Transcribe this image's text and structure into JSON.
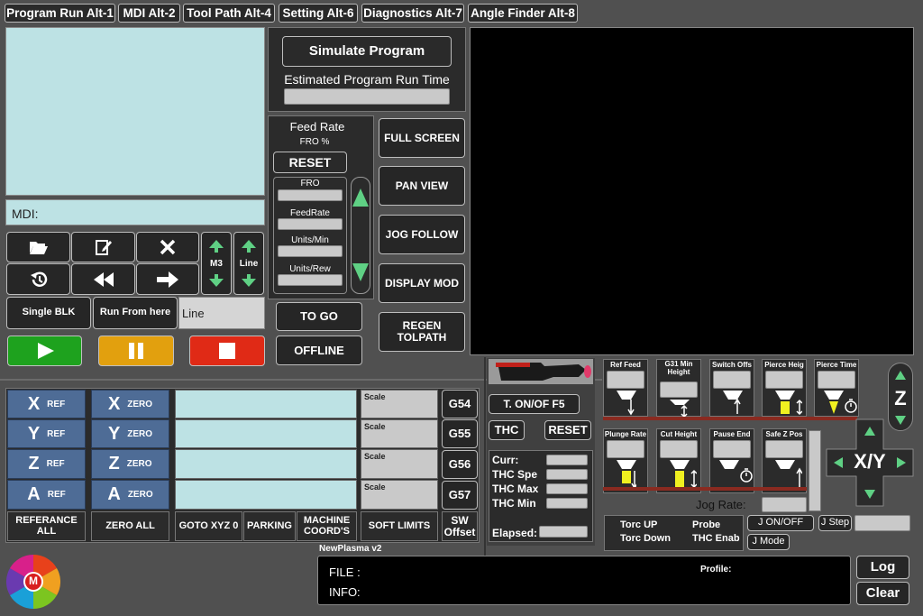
{
  "tabs": [
    "Program Run Alt-1",
    "MDI Alt-2",
    "Tool Path Alt-4",
    "Setting Alt-6",
    "Diagnostics Alt-7",
    "Angle Finder Alt-8"
  ],
  "mdi_label": "MDI:",
  "simulate": {
    "button": "Simulate Program",
    "est_label": "Estimated Program Run Time"
  },
  "feed": {
    "title": "Feed Rate",
    "fro_pct": "FRO %",
    "reset": "RESET",
    "fro": "FRO",
    "feedrate": "FeedRate",
    "units_min": "Units/Min",
    "units_rev": "Units/Rew"
  },
  "view_buttons": [
    "FULL SCREEN",
    "PAN VIEW",
    "JOG FOLLOW",
    "DISPLAY MOD"
  ],
  "regen": "REGEN TOLPATH",
  "to_go": "TO GO",
  "offline": "OFFLINE",
  "m3_label": "M3",
  "line_label": "Line",
  "single_blk": "Single BLK",
  "run_from_here": "Run From here",
  "line_field": "Line",
  "axes": [
    {
      "axis": "X"
    },
    {
      "axis": "Y"
    },
    {
      "axis": "Z"
    },
    {
      "axis": "A"
    }
  ],
  "ref_label": "REF",
  "zero_label": "ZERO",
  "ref_all": "REFERANCE ALL",
  "zero_all": "ZERO ALL",
  "scale_label": "Scale",
  "g_codes": [
    "G54",
    "G55",
    "G56",
    "G57"
  ],
  "goto_xyz0": "GOTO  XYZ 0",
  "parking": "PARKING",
  "machine_coords": "MACHINE COORD'S",
  "soft_limits": "SOFT LIMITS",
  "sw_offset": "SW Offset",
  "torch_onoff": "T. ON/OF F5",
  "thc": "THC",
  "thc_reset": "RESET",
  "curr_label": "Curr:",
  "thc_spe": "THC Spe",
  "thc_max": "THC Max",
  "thc_min": "THC Min",
  "elapsed": "Elapsed:",
  "plasma_params": [
    "Ref Feed",
    "G31 Min Height",
    "Switch Offs",
    "Pierce Heig",
    "Pierce Time",
    "Plunge Rate",
    "Cut Height",
    "Pause End",
    "Safe Z Pos"
  ],
  "jog_rate": "Jog Rate:",
  "torc_up": "Torc UP",
  "torc_down": "Torc Down",
  "probe": "Probe",
  "thc_enab": "THC Enab",
  "j_onoff": "J ON/OFF",
  "j_step": "J Step",
  "j_mode": "J Mode",
  "z_label": "Z",
  "xy_label": "X/Y",
  "profile_name": "NewPlasma v2",
  "file_label": "FILE :",
  "info_label": "INFO:",
  "profile_label": "Profile:",
  "log": "Log",
  "clear": "Clear",
  "logo_letter": "M",
  "colors": {
    "play": "#1ea21e",
    "pause": "#e2a00e",
    "stop": "#e02a16",
    "axis_blue": "#4e6c96",
    "arrow_green": "#5fd084"
  }
}
